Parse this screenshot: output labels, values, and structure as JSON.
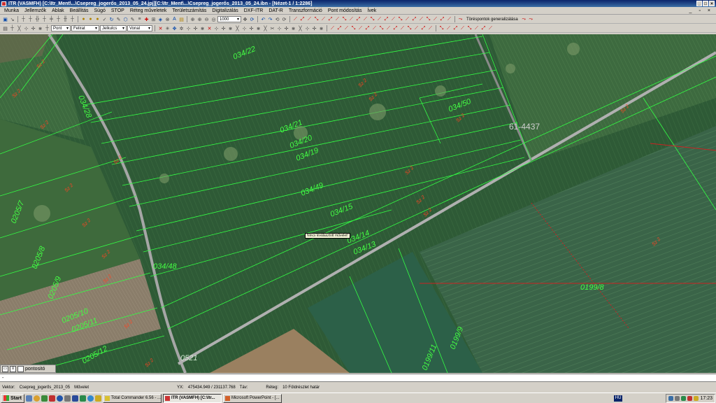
{
  "window": {
    "title": "ITR (VASMFH) [C:\\Itr_Ment\\...\\Csepreg_jogerős_2013_05_24.jpj][C:\\Itr_Ment\\...\\Csepreg_jogerős_2013_05_24.ibn - [Nézet-1 / 1:2286]"
  },
  "menu": [
    "Munka",
    "Jellemzők",
    "Ablak",
    "Beállítás",
    "Súgó",
    "STOP",
    "Réteg műveletek",
    "Területszámítás",
    "Digitalizálás",
    "DXF-ITR",
    "DAT-R",
    "Transzformáció",
    "Pont módosítás",
    "Ívek"
  ],
  "toolbar": {
    "scale_value": "1000",
    "generalize_label": "Töréspontok generalizálása",
    "combo_point": "Pont",
    "combo_label": "Felirat",
    "combo_symbol": "Jelkulcs",
    "combo_line": "Vonal"
  },
  "map": {
    "tooltip": "Nincs kiválasztott művelet!",
    "parcel_labels": [
      "034/22",
      "034/28",
      "034/21",
      "034/20",
      "034/19",
      "034/50",
      "034/49",
      "034/15",
      "034/14",
      "034/13",
      "034/48",
      "0205/7",
      "0205/8",
      "0205/9",
      "0205/10",
      "0205/11",
      "0205/12",
      "0199/8",
      "0199/9",
      "0199/11",
      "0521",
      "61-4437"
    ],
    "quality_label": "Sz 2",
    "colors": {
      "parcel_line": "#33ff44",
      "label_green": "#44ff44",
      "label_red": "#ff4422",
      "road": "#9a9a9a"
    }
  },
  "layer_panel": {
    "layer_name": "pontositó"
  },
  "command_line": {
    "text": "-"
  },
  "status": {
    "vector_label": "Vektor:",
    "vector_value": "Csepreg_jogerős_2013_05",
    "operation_label": "Művelet",
    "xy_label": "YX:",
    "xy_value": "475434.949 / 231137.768",
    "distance_label": "Táv:",
    "layer_label": "Réteg:",
    "layer_value": "10 Földrészlet határ"
  },
  "taskbar": {
    "start_label": "Start",
    "tasks": [
      "Total Commander 6.56 - ...",
      "ITR (VASMFH) [C:\\Itr...",
      "Microsoft PowerPoint - [..."
    ],
    "active_task": 1,
    "language": "HU",
    "clock": "17:23"
  }
}
